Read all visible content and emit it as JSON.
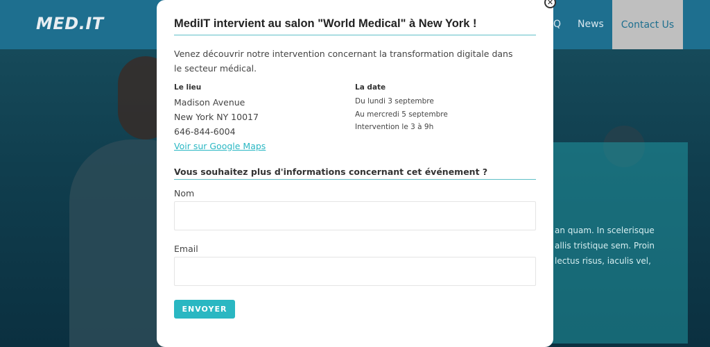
{
  "colors": {
    "accent": "#2ab7c2",
    "navbar": "#1e6f8f",
    "link": "#29b7c3",
    "active_nav_bg": "#bfbfbf"
  },
  "site": {
    "logo": "MED.IT",
    "nav": {
      "faq": "Q",
      "news": "News",
      "contact": "Contact Us"
    },
    "hero_text": [
      "an quam. In scelerisque",
      "allis tristique sem. Proin",
      "lectus risus, iaculis vel,"
    ]
  },
  "modal": {
    "close_icon": "close-icon",
    "title": "MediIT intervient au salon \"World Medical\" à New York !",
    "intro": "Venez découvrir notre intervention concernant la transformation digitale dans le secteur médical.",
    "location": {
      "label": "Le lieu",
      "street": "Madison Avenue",
      "city": "New York NY 10017",
      "phone": "646-844-6004",
      "map_link": "Voir sur Google Maps"
    },
    "date": {
      "label": "La date",
      "start": "Du lundi 3 septembre",
      "end": "Au mercredi 5 septembre",
      "time": "Intervention le 3 à 9h"
    },
    "form": {
      "heading": "Vous souhaitez plus d'informations concernant cet événement ?",
      "name_label": "Nom",
      "name_value": "",
      "email_label": "Email",
      "email_value": "",
      "submit": "ENVOYER"
    }
  }
}
